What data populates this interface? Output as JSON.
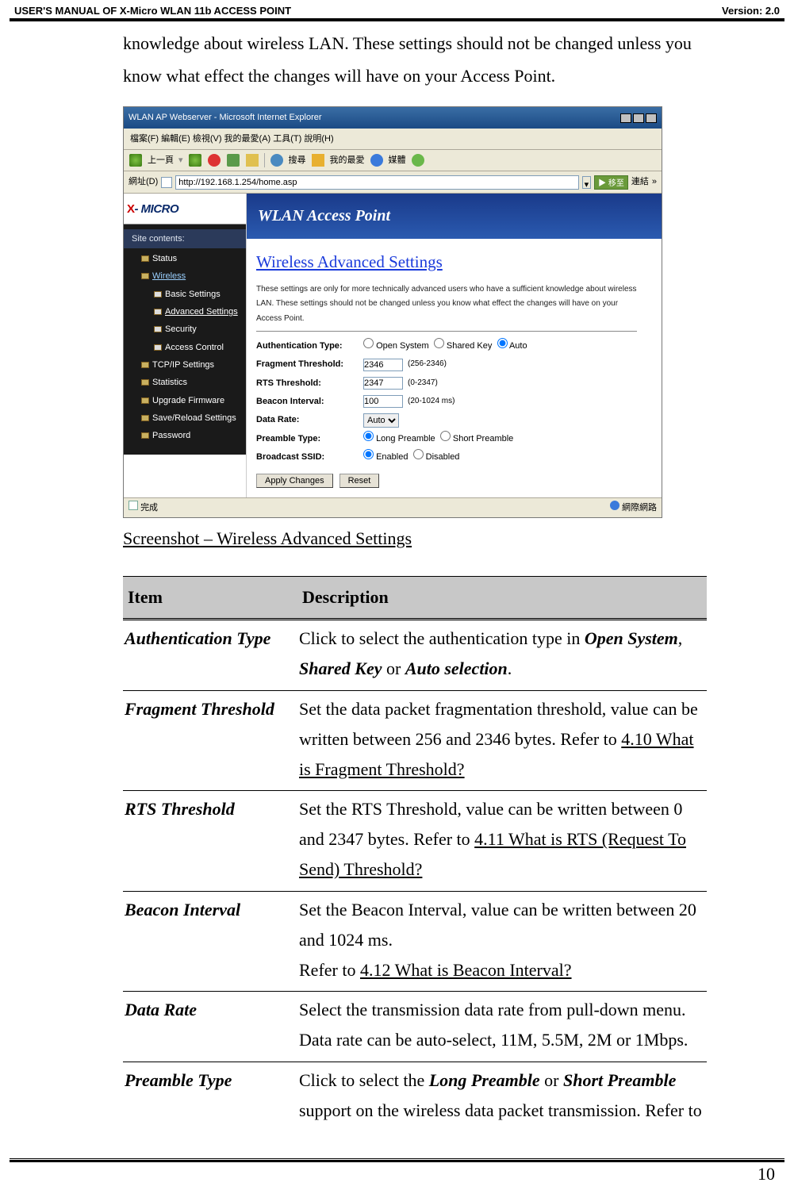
{
  "header": {
    "left": "USER'S MANUAL OF X-Micro WLAN 11b ACCESS POINT",
    "right": "Version: 2.0"
  },
  "intro": "knowledge about wireless LAN. These settings should not be changed unless you know what effect the changes will have on your Access Point.",
  "screenshot": {
    "window_title": "WLAN AP Webserver - Microsoft Internet Explorer",
    "menu": "檔案(F)   編輯(E)   檢視(V)   我的最愛(A)   工具(T)   說明(H)",
    "toolbar": {
      "back": "上一頁",
      "search": "搜尋",
      "fav": "我的最愛",
      "media": "媒體"
    },
    "address_label": "網址(D)",
    "address_value": "http://192.168.1.254/home.asp",
    "go": "移至",
    "links": "連結",
    "logo": "X- MICRO",
    "sidebar": {
      "title": "Site contents:",
      "items": [
        "Status",
        "Wireless",
        "Basic Settings",
        "Advanced Settings",
        "Security",
        "Access Control",
        "TCP/IP Settings",
        "Statistics",
        "Upgrade Firmware",
        "Save/Reload Settings",
        "Password"
      ]
    },
    "hero": "WLAN Access Point",
    "panel_title": "Wireless Advanced Settings",
    "panel_note": "These settings are only for more technically advanced users who have a sufficient knowledge about wireless LAN. These settings should not be changed unless you know what effect the changes will have on your Access Point.",
    "fields": {
      "auth": {
        "label": "Authentication Type:",
        "o1": "Open System",
        "o2": "Shared Key",
        "o3": "Auto"
      },
      "frag": {
        "label": "Fragment Threshold:",
        "value": "2346",
        "hint": "(256-2346)"
      },
      "rts": {
        "label": "RTS Threshold:",
        "value": "2347",
        "hint": "(0-2347)"
      },
      "beacon": {
        "label": "Beacon Interval:",
        "value": "100",
        "hint": "(20-1024 ms)"
      },
      "rate": {
        "label": "Data Rate:",
        "value": "Auto"
      },
      "preamble": {
        "label": "Preamble Type:",
        "o1": "Long Preamble",
        "o2": "Short Preamble"
      },
      "bssid": {
        "label": "Broadcast SSID:",
        "o1": "Enabled",
        "o2": "Disabled"
      }
    },
    "apply": "Apply Changes",
    "reset": "Reset",
    "status_done": "完成",
    "status_net": "網際網路"
  },
  "caption": "Screenshot – Wireless Advanced Settings",
  "table": {
    "head": {
      "c1": "Item",
      "c2": "Description"
    },
    "rows": [
      {
        "item": "Authentication Type",
        "desc_pre": "Click to select the authentication type in ",
        "b1": "Open System",
        "sep1": ", ",
        "b2": "Shared Key",
        "sep2": " or ",
        "b3": "Auto selection",
        "tail": "."
      },
      {
        "item": "Fragment Threshold",
        "desc_pre": "Set the data packet fragmentation threshold, value can be written between 256 and 2346 bytes. Refer to ",
        "link": "4.10 What is Fragment Threshold?"
      },
      {
        "item": "RTS Threshold",
        "desc_pre": "Set the RTS Threshold, value can be written between 0 and 2347 bytes. Refer to ",
        "link": "4.11 What is RTS (Request To Send) Threshold?"
      },
      {
        "item": "Beacon Interval",
        "line1": "Set the Beacon Interval, value can be written between 20 and 1024 ms.",
        "line2_pre": "Refer to ",
        "link": "4.12 What is Beacon Interval?"
      },
      {
        "item": "Data Rate",
        "desc": "Select the transmission data rate from pull-down menu. Data rate can be auto-select, 11M, 5.5M, 2M or 1Mbps."
      },
      {
        "item": "Preamble Type",
        "desc_pre": "Click to select the ",
        "b1": "Long Preamble",
        "sep1": " or ",
        "b2": "Short Preamble",
        "tail": " support on the wireless data packet transmission. Refer to"
      }
    ]
  },
  "pagenum": "10"
}
